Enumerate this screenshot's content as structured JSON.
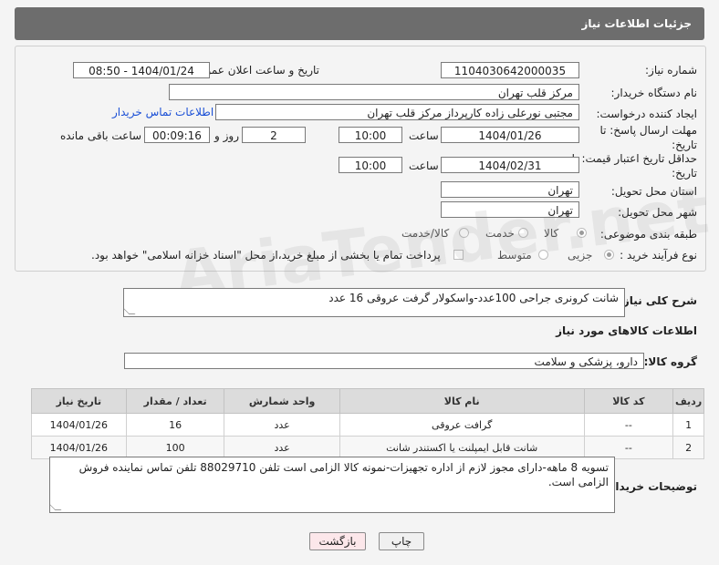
{
  "header": {
    "title": "جزئیات اطلاعات نیاز"
  },
  "form": {
    "need_number_label": "شماره نیاز:",
    "need_number": "1104030642000035",
    "announce_label": "تاریخ و ساعت اعلان عمومی:",
    "announce_value": "1404/01/24 - 08:50",
    "buyer_org_label": "نام دستگاه خریدار:",
    "buyer_org": "مرکز قلب تهران",
    "requester_label": "ایجاد کننده درخواست:",
    "requester": "مجتبی نورعلی زاده کارپرداز مرکز قلب تهران",
    "contact_link": "اطلاعات تماس خریدار",
    "deadline_label": "مهلت ارسال پاسخ: تا تاریخ:",
    "deadline_date": "1404/01/26",
    "time_label": "ساعت",
    "deadline_time": "10:00",
    "days_value": "2",
    "days_label": "روز و",
    "remaining_time": "00:09:16",
    "remaining_label": "ساعت باقی مانده",
    "validity_label": "حداقل تاریخ اعتبار قیمت: تا تاریخ:",
    "validity_date": "1404/02/31",
    "validity_time": "10:00",
    "province_label": "استان محل تحویل:",
    "province": "تهران",
    "city_label": "شهر محل تحویل:",
    "city": "تهران",
    "category_label": "طبقه بندی موضوعی:",
    "category_options": [
      "کالا",
      "خدمت",
      "کالا/خدمت"
    ],
    "process_label": "نوع فرآیند خرید :",
    "process_options": [
      "جزیی",
      "متوسط"
    ],
    "payment_note": "پرداخت تمام یا بخشی از مبلغ خرید،از محل \"اسناد خزانه اسلامی\" خواهد بود."
  },
  "summary": {
    "label": "شرح کلی نیاز:",
    "text": "شانت کرونری جراحی 100عدد-واسکولار گرفت عروقی 16 عدد"
  },
  "goods": {
    "section_title": "اطلاعات کالاهای مورد نیاز",
    "group_label": "گروه کالا:",
    "group_value": "دارو، پزشکی و سلامت",
    "columns": [
      "ردیف",
      "کد کالا",
      "نام کالا",
      "واحد شمارش",
      "تعداد / مقدار",
      "تاریخ نیاز"
    ],
    "rows": [
      [
        "1",
        "--",
        "گرافت عروقی",
        "عدد",
        "16",
        "1404/01/26"
      ],
      [
        "2",
        "--",
        "شانت قابل ایمپلنت یا اکستندر شانت",
        "عدد",
        "100",
        "1404/01/26"
      ]
    ]
  },
  "buyer_notes": {
    "label": "توضیحات خریدار:",
    "text": "تسویه 8 ماهه-دارای مجوز لازم از اداره تجهیزات-نمونه کالا الزامی است تلفن 88029710 تلفن تماس نماینده فروش الزامی است."
  },
  "buttons": {
    "print": "چاپ",
    "back": "بازگشت"
  },
  "colors": {
    "header_bg": "#6d6d6d",
    "link": "#1a4fd6",
    "back_bg": "#fce7ea"
  }
}
